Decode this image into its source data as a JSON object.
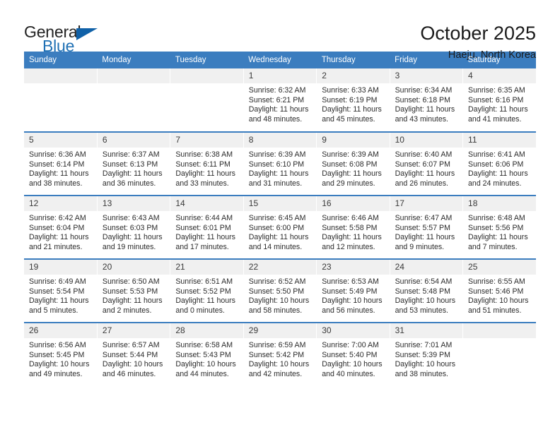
{
  "brand": {
    "name_top": "General",
    "name_bottom": "Blue",
    "accent_color": "#2071b5",
    "triangle_color": "#1061a8"
  },
  "header": {
    "title": "October 2025",
    "subtitle": "Haeju, North Korea"
  },
  "calendar": {
    "header_bg": "#3b7dbf",
    "daynum_bg": "#f0f0f0",
    "weekday_headers": [
      "Sunday",
      "Monday",
      "Tuesday",
      "Wednesday",
      "Thursday",
      "Friday",
      "Saturday"
    ],
    "weeks": [
      [
        {
          "day": "",
          "lines": []
        },
        {
          "day": "",
          "lines": []
        },
        {
          "day": "",
          "lines": []
        },
        {
          "day": "1",
          "lines": [
            "Sunrise: 6:32 AM",
            "Sunset: 6:21 PM",
            "Daylight: 11 hours",
            "and 48 minutes."
          ]
        },
        {
          "day": "2",
          "lines": [
            "Sunrise: 6:33 AM",
            "Sunset: 6:19 PM",
            "Daylight: 11 hours",
            "and 45 minutes."
          ]
        },
        {
          "day": "3",
          "lines": [
            "Sunrise: 6:34 AM",
            "Sunset: 6:18 PM",
            "Daylight: 11 hours",
            "and 43 minutes."
          ]
        },
        {
          "day": "4",
          "lines": [
            "Sunrise: 6:35 AM",
            "Sunset: 6:16 PM",
            "Daylight: 11 hours",
            "and 41 minutes."
          ]
        }
      ],
      [
        {
          "day": "5",
          "lines": [
            "Sunrise: 6:36 AM",
            "Sunset: 6:14 PM",
            "Daylight: 11 hours",
            "and 38 minutes."
          ]
        },
        {
          "day": "6",
          "lines": [
            "Sunrise: 6:37 AM",
            "Sunset: 6:13 PM",
            "Daylight: 11 hours",
            "and 36 minutes."
          ]
        },
        {
          "day": "7",
          "lines": [
            "Sunrise: 6:38 AM",
            "Sunset: 6:11 PM",
            "Daylight: 11 hours",
            "and 33 minutes."
          ]
        },
        {
          "day": "8",
          "lines": [
            "Sunrise: 6:39 AM",
            "Sunset: 6:10 PM",
            "Daylight: 11 hours",
            "and 31 minutes."
          ]
        },
        {
          "day": "9",
          "lines": [
            "Sunrise: 6:39 AM",
            "Sunset: 6:08 PM",
            "Daylight: 11 hours",
            "and 29 minutes."
          ]
        },
        {
          "day": "10",
          "lines": [
            "Sunrise: 6:40 AM",
            "Sunset: 6:07 PM",
            "Daylight: 11 hours",
            "and 26 minutes."
          ]
        },
        {
          "day": "11",
          "lines": [
            "Sunrise: 6:41 AM",
            "Sunset: 6:06 PM",
            "Daylight: 11 hours",
            "and 24 minutes."
          ]
        }
      ],
      [
        {
          "day": "12",
          "lines": [
            "Sunrise: 6:42 AM",
            "Sunset: 6:04 PM",
            "Daylight: 11 hours",
            "and 21 minutes."
          ]
        },
        {
          "day": "13",
          "lines": [
            "Sunrise: 6:43 AM",
            "Sunset: 6:03 PM",
            "Daylight: 11 hours",
            "and 19 minutes."
          ]
        },
        {
          "day": "14",
          "lines": [
            "Sunrise: 6:44 AM",
            "Sunset: 6:01 PM",
            "Daylight: 11 hours",
            "and 17 minutes."
          ]
        },
        {
          "day": "15",
          "lines": [
            "Sunrise: 6:45 AM",
            "Sunset: 6:00 PM",
            "Daylight: 11 hours",
            "and 14 minutes."
          ]
        },
        {
          "day": "16",
          "lines": [
            "Sunrise: 6:46 AM",
            "Sunset: 5:58 PM",
            "Daylight: 11 hours",
            "and 12 minutes."
          ]
        },
        {
          "day": "17",
          "lines": [
            "Sunrise: 6:47 AM",
            "Sunset: 5:57 PM",
            "Daylight: 11 hours",
            "and 9 minutes."
          ]
        },
        {
          "day": "18",
          "lines": [
            "Sunrise: 6:48 AM",
            "Sunset: 5:56 PM",
            "Daylight: 11 hours",
            "and 7 minutes."
          ]
        }
      ],
      [
        {
          "day": "19",
          "lines": [
            "Sunrise: 6:49 AM",
            "Sunset: 5:54 PM",
            "Daylight: 11 hours",
            "and 5 minutes."
          ]
        },
        {
          "day": "20",
          "lines": [
            "Sunrise: 6:50 AM",
            "Sunset: 5:53 PM",
            "Daylight: 11 hours",
            "and 2 minutes."
          ]
        },
        {
          "day": "21",
          "lines": [
            "Sunrise: 6:51 AM",
            "Sunset: 5:52 PM",
            "Daylight: 11 hours",
            "and 0 minutes."
          ]
        },
        {
          "day": "22",
          "lines": [
            "Sunrise: 6:52 AM",
            "Sunset: 5:50 PM",
            "Daylight: 10 hours",
            "and 58 minutes."
          ]
        },
        {
          "day": "23",
          "lines": [
            "Sunrise: 6:53 AM",
            "Sunset: 5:49 PM",
            "Daylight: 10 hours",
            "and 56 minutes."
          ]
        },
        {
          "day": "24",
          "lines": [
            "Sunrise: 6:54 AM",
            "Sunset: 5:48 PM",
            "Daylight: 10 hours",
            "and 53 minutes."
          ]
        },
        {
          "day": "25",
          "lines": [
            "Sunrise: 6:55 AM",
            "Sunset: 5:46 PM",
            "Daylight: 10 hours",
            "and 51 minutes."
          ]
        }
      ],
      [
        {
          "day": "26",
          "lines": [
            "Sunrise: 6:56 AM",
            "Sunset: 5:45 PM",
            "Daylight: 10 hours",
            "and 49 minutes."
          ]
        },
        {
          "day": "27",
          "lines": [
            "Sunrise: 6:57 AM",
            "Sunset: 5:44 PM",
            "Daylight: 10 hours",
            "and 46 minutes."
          ]
        },
        {
          "day": "28",
          "lines": [
            "Sunrise: 6:58 AM",
            "Sunset: 5:43 PM",
            "Daylight: 10 hours",
            "and 44 minutes."
          ]
        },
        {
          "day": "29",
          "lines": [
            "Sunrise: 6:59 AM",
            "Sunset: 5:42 PM",
            "Daylight: 10 hours",
            "and 42 minutes."
          ]
        },
        {
          "day": "30",
          "lines": [
            "Sunrise: 7:00 AM",
            "Sunset: 5:40 PM",
            "Daylight: 10 hours",
            "and 40 minutes."
          ]
        },
        {
          "day": "31",
          "lines": [
            "Sunrise: 7:01 AM",
            "Sunset: 5:39 PM",
            "Daylight: 10 hours",
            "and 38 minutes."
          ]
        },
        {
          "day": "",
          "lines": []
        }
      ]
    ]
  }
}
